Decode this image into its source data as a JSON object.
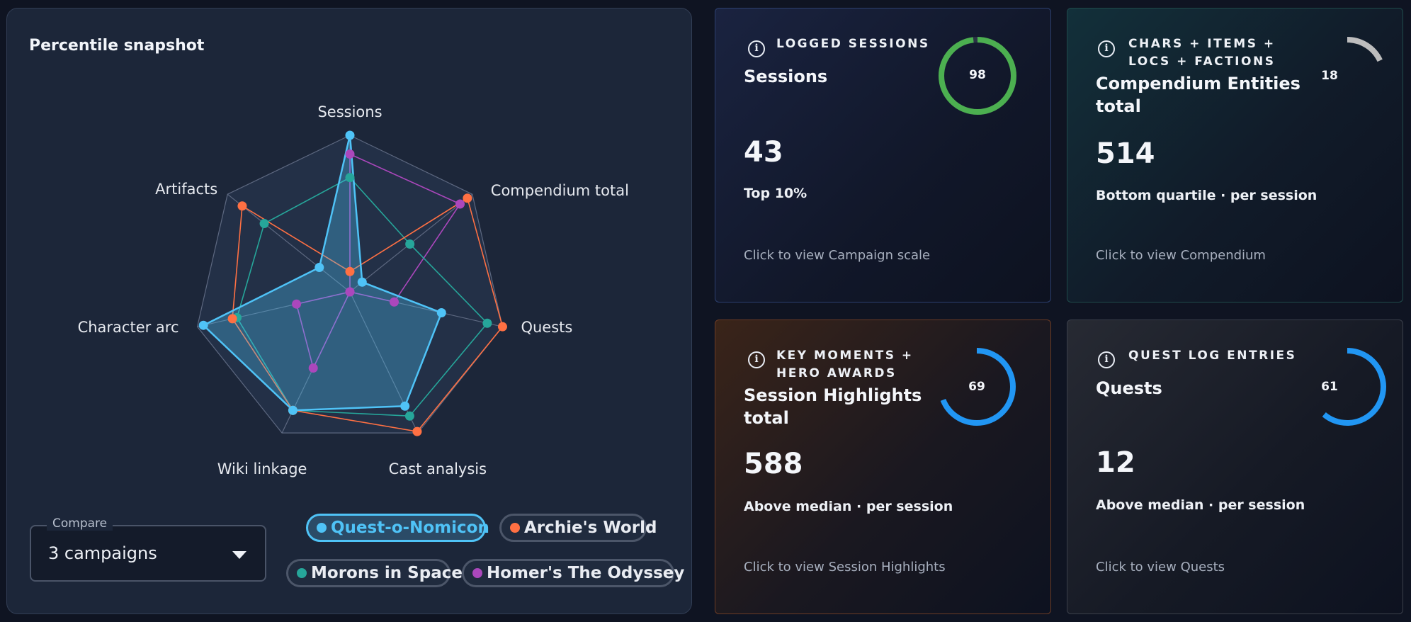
{
  "percentile": {
    "title": "Percentile snapshot",
    "axes": [
      "Sessions",
      "Compendium total",
      "Quests",
      "Cast analysis",
      "Wiki linkage",
      "Character arc",
      "Artifacts"
    ],
    "series": [
      {
        "name": "Quest-o-Nomicon",
        "color": "#4fc3f7",
        "values": [
          1.0,
          0.1,
          0.6,
          0.81,
          0.84,
          0.96,
          0.25
        ]
      },
      {
        "name": "Archie's World",
        "color": "#ff7043",
        "values": [
          0.13,
          0.96,
          1.0,
          0.99,
          0.84,
          0.77,
          0.88
        ]
      },
      {
        "name": "Morons in Space",
        "color": "#26a69a",
        "values": [
          0.73,
          0.49,
          0.9,
          0.88,
          0.84,
          0.74,
          0.7
        ]
      },
      {
        "name": "Homer's The Odyssey",
        "color": "#ab47bc",
        "values": [
          0.88,
          0.9,
          0.29,
          0.0,
          0.54,
          0.35,
          0.0
        ]
      }
    ],
    "compare": {
      "legend": "Compare",
      "value": "3 campaigns"
    },
    "active_series": "Quest-o-Nomicon"
  },
  "cards": [
    {
      "eyebrow": "LOGGED SESSIONS",
      "title": "Sessions",
      "value": "43",
      "desc": "Top 10%",
      "link": "Click to view Campaign scale",
      "percentile": 98,
      "ring_color": "#4caf50",
      "border": "#2c3f6e",
      "bg": "linear-gradient(135deg,#1a2340 0%,#111729 60%,#0d1220 100%)"
    },
    {
      "eyebrow": "CHARS + ITEMS + LOCS + FACTIONS",
      "title": "Compendium Entities total",
      "value": "514",
      "desc": "Bottom quartile · per session",
      "link": "Click to view Compendium",
      "percentile": 18,
      "ring_color": "#bdbdbd",
      "border": "#1f4a4a",
      "bg": "linear-gradient(135deg,#12303a 0%,#111b29 55%,#0d1220 100%)"
    },
    {
      "eyebrow": "KEY MOMENTS + HERO AWARDS",
      "title": "Session Highlights total",
      "value": "588",
      "desc": "Above median · per session",
      "link": "Click to view Session Highlights",
      "percentile": 69,
      "ring_color": "#2196f3",
      "border": "#6a3b25",
      "bg": "linear-gradient(135deg,#3a2419 0%,#1a1820 55%,#0d1220 100%)"
    },
    {
      "eyebrow": "QUEST LOG ENTRIES",
      "title": "Quests",
      "value": "12",
      "desc": "Above median · per session",
      "link": "Click to view Quests",
      "percentile": 61,
      "ring_color": "#2196f3",
      "border": "#3a3f4a",
      "bg": "linear-gradient(135deg,#272a33 0%,#161a25 55%,#0d1220 100%)"
    }
  ]
}
